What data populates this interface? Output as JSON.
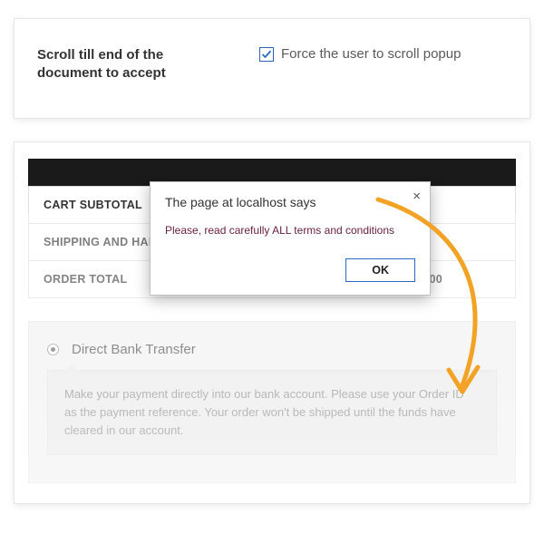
{
  "settings": {
    "label": "Scroll till end of the document to accept",
    "checkbox_checked": true,
    "checkbox_label": "Force the user to scroll popup"
  },
  "alert": {
    "title": "The page at localhost says",
    "message": "Please, read carefully ALL terms and conditions",
    "ok_label": "OK",
    "close_glyph": "×"
  },
  "checkout": {
    "rows": [
      {
        "label": "CART SUBTOTAL",
        "value": ""
      },
      {
        "label": "SHIPPING AND HAN",
        "value": ""
      },
      {
        "label": "ORDER TOTAL",
        "value": "£12.00"
      }
    ],
    "payment": {
      "title": "Direct Bank Transfer",
      "description": "Make your payment directly into our bank account. Please use your Order ID as the payment reference. Your order won't be shipped until the funds have cleared in our account."
    }
  },
  "colors": {
    "accent_blue": "#2a69c4",
    "arrow_orange": "#f2a225",
    "alert_text": "#6b2142"
  }
}
